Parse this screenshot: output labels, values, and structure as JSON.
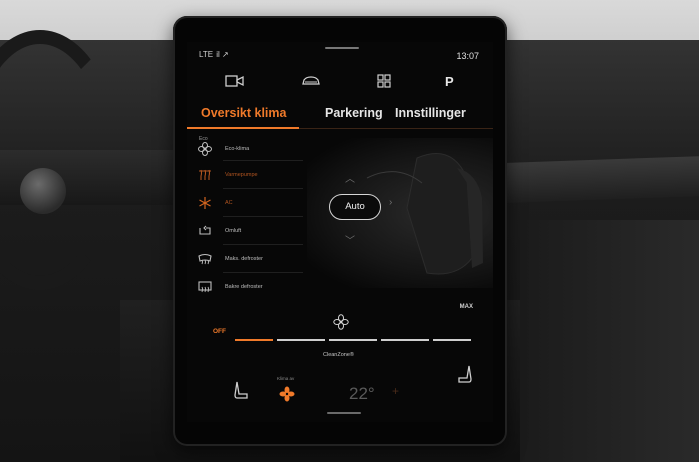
{
  "status": {
    "network": "LTE  il ↗",
    "time": "13:07"
  },
  "topbar": {
    "icons": [
      "camera-icon",
      "car-icon",
      "grid-icon",
      "parking-icon"
    ],
    "park_letter": "P"
  },
  "tabs": [
    {
      "label": "Oversikt klima",
      "active": true
    },
    {
      "label": "Parkering",
      "active": false
    },
    {
      "label": "Innstillinger",
      "active": false
    }
  ],
  "climate_list": [
    {
      "label": "Eco-klima",
      "tag": "Eco",
      "icon": "eco-fan-icon",
      "active": false
    },
    {
      "label": "Varmepumpe",
      "icon": "heat-pump-icon",
      "active": true
    },
    {
      "label": "AC",
      "icon": "snowflake-icon",
      "active": true
    },
    {
      "label": "Omluft",
      "icon": "recirculation-icon",
      "active": false
    },
    {
      "label": "Maks. defroster",
      "icon": "front-defrost-icon",
      "active": false
    },
    {
      "label": "Bakre defroster",
      "icon": "rear-defrost-icon",
      "active": false
    }
  ],
  "auto_button": {
    "label": "Auto"
  },
  "fan": {
    "off_label": "OFF",
    "max_label": "MAX",
    "level": 0.1
  },
  "cleanzone": {
    "label": "CleanZone®"
  },
  "bottom": {
    "klima_label": "Klima av",
    "temperature": "22°",
    "plus": "+"
  },
  "colors": {
    "accent": "#f07a2a",
    "screen_bg": "#070707",
    "text": "#d9d9d9"
  }
}
